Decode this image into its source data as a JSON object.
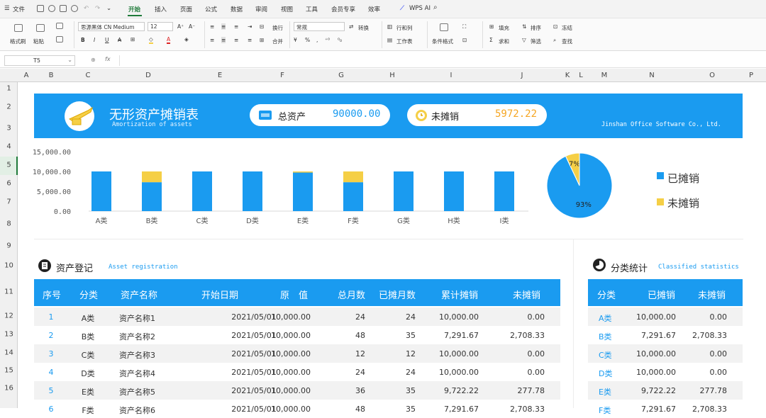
{
  "menu": {
    "file": "文件",
    "tabs": [
      "开始",
      "插入",
      "页面",
      "公式",
      "数据",
      "审阅",
      "视图",
      "工具",
      "会员专享",
      "效率"
    ],
    "wps_ai": "WPS AI"
  },
  "ribbon": {
    "format_painter": "格式刷",
    "paste": "粘贴",
    "font_name": "思源黑体 CN Medium",
    "font_size": "12",
    "wrap": "换行",
    "merge": "合并",
    "number_format": "常规",
    "convert": "转换",
    "row_col": "行和列",
    "worksheet": "工作表",
    "cond_format": "条件格式",
    "fill": "填充",
    "sort": "排序",
    "freeze": "冻结",
    "sum": "求和",
    "filter": "筛选",
    "find": "查找"
  },
  "formula_bar": {
    "cell_ref": "T5",
    "fx": "fx",
    "content": ""
  },
  "columns": [
    "A",
    "B",
    "C",
    "D",
    "E",
    "F",
    "G",
    "H",
    "I",
    "J",
    "K",
    "L",
    "M",
    "N",
    "O",
    "P"
  ],
  "rows": [
    "1",
    "2",
    "3",
    "4",
    "5",
    "6",
    "7",
    "8",
    "9",
    "10",
    "11",
    "12",
    "13",
    "14",
    "15",
    "16"
  ],
  "banner": {
    "title": "无形资产摊销表",
    "subtitle": "Amortization of assets",
    "total_label": "总资产",
    "total_value": "90000.00",
    "unamort_label": "未摊销",
    "unamort_value": "5972.22",
    "company": "Jinshan Office Software Co., Ltd."
  },
  "colors": {
    "accent": "#1a9bf0",
    "yellow": "#f5cf46",
    "green": "#1f7a3a",
    "orange_value": "#f5a623"
  },
  "chart_data": [
    {
      "type": "bar",
      "stacked": true,
      "categories": [
        "A类",
        "B类",
        "C类",
        "D类",
        "E类",
        "F类",
        "G类",
        "H类",
        "I类"
      ],
      "series": [
        {
          "name": "已摊销",
          "values": [
            10000,
            7291.67,
            10000,
            10000,
            9722.22,
            7291.67,
            10000,
            10000,
            10000
          ]
        },
        {
          "name": "未摊销",
          "values": [
            0,
            2708.33,
            0,
            0,
            277.78,
            2708.33,
            0,
            0,
            0
          ]
        }
      ],
      "yticks": [
        "15,000.00",
        "10,000.00",
        "5,000.00",
        "0.00"
      ],
      "ylim": [
        0,
        15000
      ],
      "grid": false
    },
    {
      "type": "pie",
      "slices": [
        {
          "name": "已摊销",
          "value": 93,
          "label": "93%"
        },
        {
          "name": "未摊销",
          "value": 7,
          "label": "7%"
        }
      ],
      "legend": [
        "已摊销",
        "未摊销"
      ],
      "legend_position": "right"
    }
  ],
  "registration": {
    "title": "资产登记",
    "subtitle": "Asset registration",
    "headers": [
      "序号",
      "分类",
      "资产名称",
      "开始日期",
      "原　值",
      "总月数",
      "已摊月数",
      "累计摊销",
      "未摊销"
    ],
    "rows": [
      [
        "1",
        "A类",
        "资产名称1",
        "2021/05/01",
        "10,000.00",
        "24",
        "24",
        "10,000.00",
        "0.00"
      ],
      [
        "2",
        "B类",
        "资产名称2",
        "2021/05/01",
        "10,000.00",
        "48",
        "35",
        "7,291.67",
        "2,708.33"
      ],
      [
        "3",
        "C类",
        "资产名称3",
        "2021/05/01",
        "10,000.00",
        "12",
        "12",
        "10,000.00",
        "0.00"
      ],
      [
        "4",
        "D类",
        "资产名称4",
        "2021/05/01",
        "10,000.00",
        "24",
        "24",
        "10,000.00",
        "0.00"
      ],
      [
        "5",
        "E类",
        "资产名称5",
        "2021/05/01",
        "10,000.00",
        "36",
        "35",
        "9,722.22",
        "277.78"
      ],
      [
        "6",
        "F类",
        "资产名称6",
        "2021/05/01",
        "10,000.00",
        "48",
        "35",
        "7,291.67",
        "2,708.33"
      ]
    ]
  },
  "stats": {
    "title": "分类统计",
    "subtitle": "Classified statistics",
    "headers": [
      "分类",
      "已摊销",
      "未摊销"
    ],
    "rows": [
      [
        "A类",
        "10,000.00",
        "0.00"
      ],
      [
        "B类",
        "7,291.67",
        "2,708.33"
      ],
      [
        "C类",
        "10,000.00",
        "0.00"
      ],
      [
        "D类",
        "10,000.00",
        "0.00"
      ],
      [
        "E类",
        "9,722.22",
        "277.78"
      ],
      [
        "F类",
        "7,291.67",
        "2,708.33"
      ]
    ]
  }
}
